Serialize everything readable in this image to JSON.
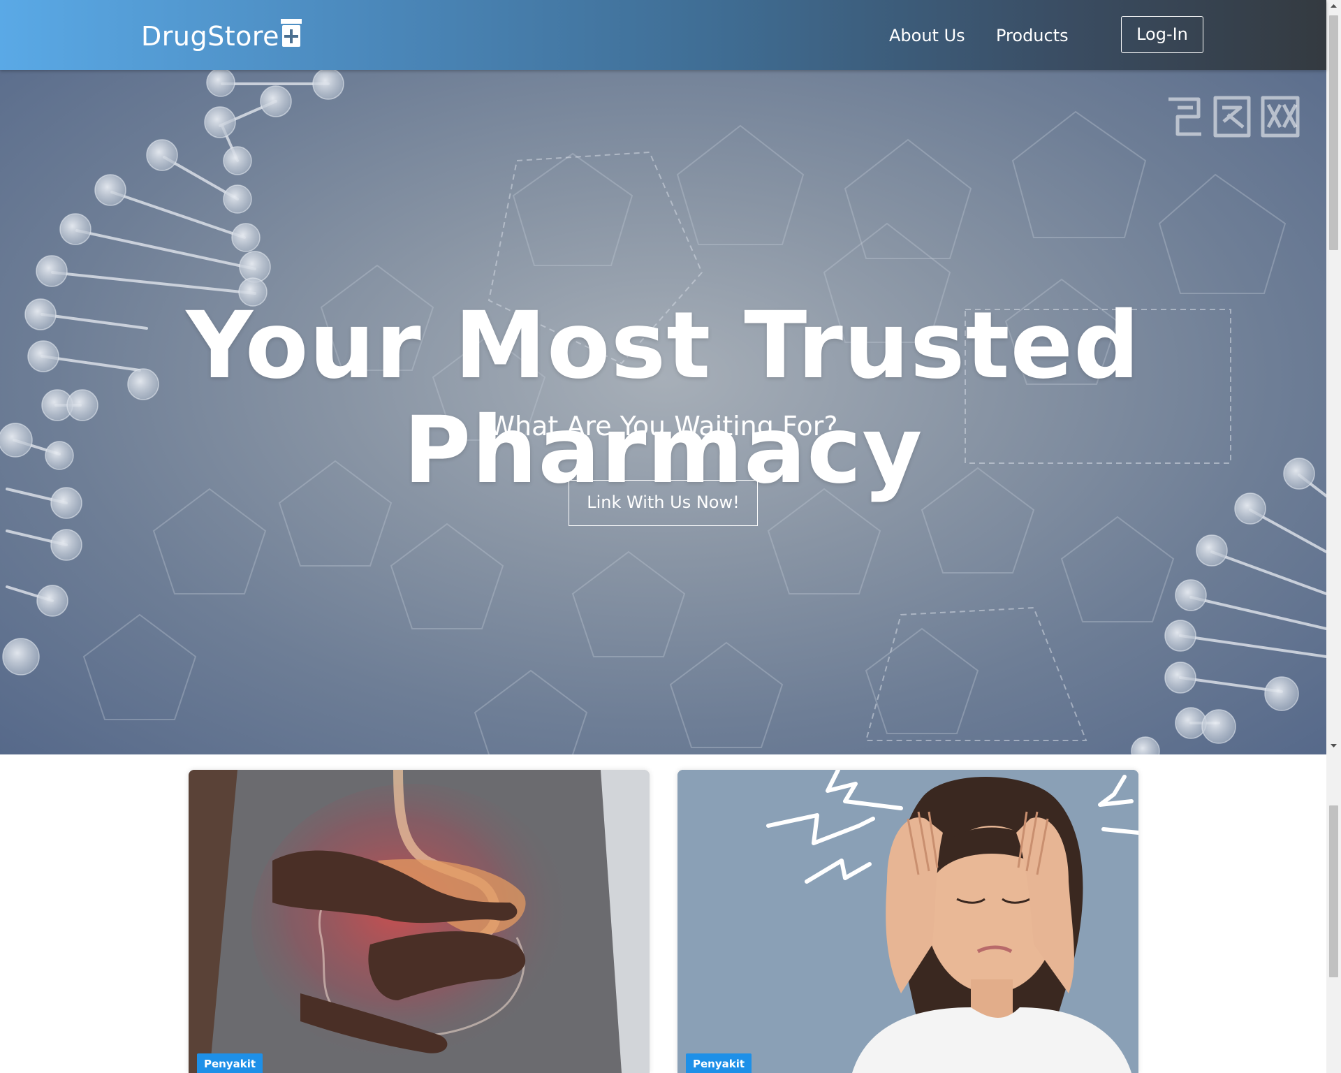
{
  "navbar": {
    "brand": "DrugStore",
    "links": [
      "About Us",
      "Products"
    ],
    "login_label": "Log-In"
  },
  "hero": {
    "title": "Your Most Trusted Pharmacy",
    "subtitle": "What Are You Waiting For?",
    "cta_label": "Link With Us Now!",
    "watermark": "包图网"
  },
  "cards": [
    {
      "badge": "Penyakit",
      "image": "stomach-ache-photo"
    },
    {
      "badge": "Penyakit",
      "image": "headache-photo"
    }
  ],
  "colors": {
    "nav_gradient_start": "#5aa9e6",
    "nav_gradient_end": "#343a40",
    "badge": "#1e90e8"
  }
}
